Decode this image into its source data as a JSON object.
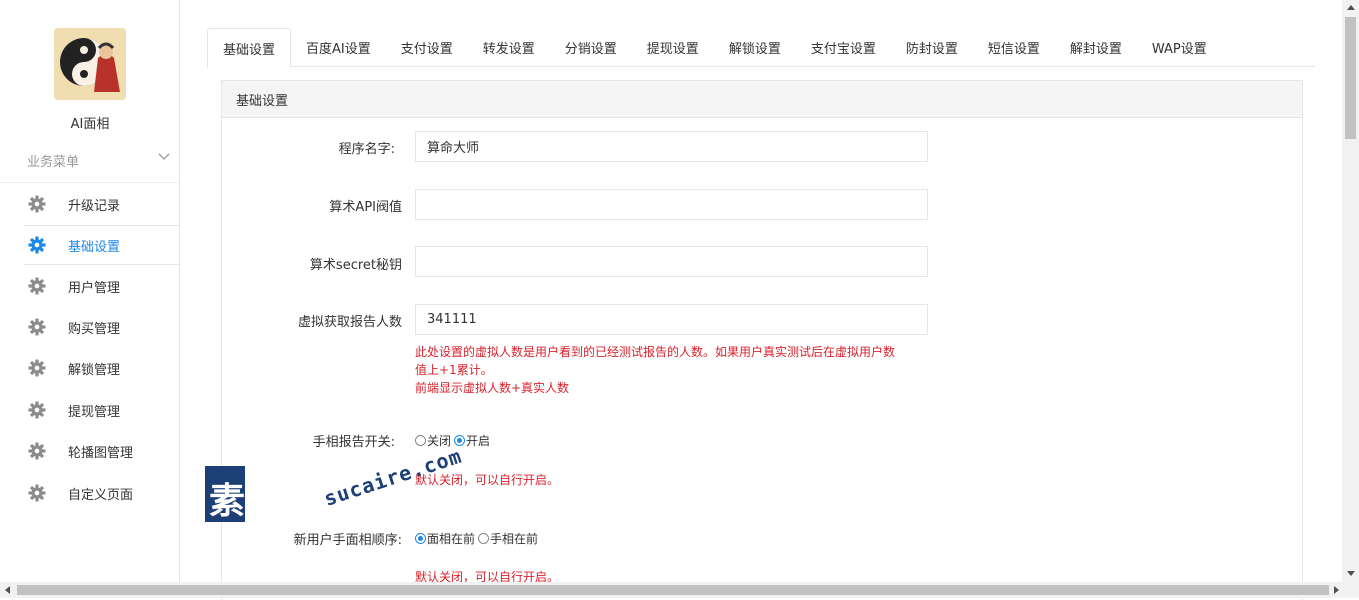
{
  "sidebar": {
    "app_name": "AI面相",
    "menu_title": "业务菜单",
    "items": [
      {
        "label": "升级记录",
        "icon": "gear-icon",
        "active": false
      },
      {
        "label": "基础设置",
        "icon": "gear-icon",
        "active": true
      },
      {
        "label": "用户管理",
        "icon": "gear-icon",
        "active": false
      },
      {
        "label": "购买管理",
        "icon": "gear-icon",
        "active": false
      },
      {
        "label": "解锁管理",
        "icon": "gear-icon",
        "active": false
      },
      {
        "label": "提现管理",
        "icon": "gear-icon",
        "active": false
      },
      {
        "label": "轮播图管理",
        "icon": "gear-icon",
        "active": false
      },
      {
        "label": "自定义页面",
        "icon": "gear-icon",
        "active": false
      }
    ]
  },
  "tabs": [
    "基础设置",
    "百度AI设置",
    "支付设置",
    "转发设置",
    "分销设置",
    "提现设置",
    "解锁设置",
    "支付宝设置",
    "防封设置",
    "短信设置",
    "解封设置",
    "WAP设置"
  ],
  "active_tab": 0,
  "panel": {
    "title": "基础设置",
    "fields": {
      "program_name": {
        "label": "程序名字:",
        "value": "算命大师"
      },
      "api_threshold": {
        "label": "算术API阀值",
        "value": ""
      },
      "secret_key": {
        "label": "算术secret秘钥",
        "value": ""
      },
      "virtual_count": {
        "label": "虚拟获取报告人数",
        "value": "341111",
        "hint_line1": "此处设置的虚拟人数是用户看到的已经测试报告的人数。如果用户真实测试后在虚拟用户数",
        "hint_line2": "值上+1累计。",
        "hint_line3": "前端显示虚拟人数+真实人数"
      },
      "palm_report_switch": {
        "label": "手相报告开关:",
        "options": [
          "关闭",
          "开启"
        ],
        "selected": "开启",
        "hint": "默认关闭，可以自行开启。"
      },
      "new_user_order": {
        "label": "新用户手面相顺序:",
        "options": [
          "面相在前",
          "手相在前"
        ],
        "selected": "面相在前",
        "hint": "默认关闭，可以自行开启。"
      }
    }
  },
  "watermark": {
    "cn": "素材熱",
    "en": "sucaire.com"
  },
  "colors": {
    "accent": "#1e88e5",
    "hint_red": "#d9232d",
    "border": "#e6e6e6",
    "header_bg": "#f5f5f5"
  }
}
